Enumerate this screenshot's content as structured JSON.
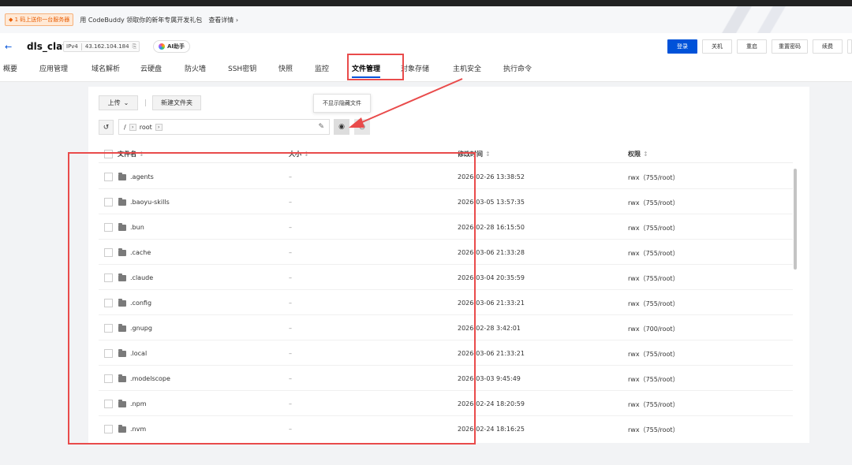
{
  "promo": {
    "tag": "◆ 1 码上送你一台服务器",
    "text": "用 CodeBuddy 领取你的新年专属开发礼包",
    "link": "查看详情 ›"
  },
  "header": {
    "back": "←",
    "instance_name": "dls_claw",
    "ip_type": "IPv4",
    "ip": "43.162.104.184",
    "copy_glyph": "⎘",
    "ai_label": "AI助手",
    "buttons": [
      "登录",
      "关机",
      "重启",
      "重置密码",
      "续费"
    ]
  },
  "tabs": [
    "概要",
    "应用管理",
    "域名解析",
    "云硬盘",
    "防火墙",
    "SSH密钥",
    "快照",
    "监控",
    "文件管理",
    "对象存储",
    "主机安全",
    "执行命令"
  ],
  "active_tab": "文件管理",
  "toolbar": {
    "upload": "上传",
    "upload_chevron": "⌄",
    "divider": "|",
    "new_folder": "新建文件夹",
    "tooltip": "不显示隐藏文件",
    "refresh_glyph": "↺",
    "path_root": "/",
    "path_sep": "›",
    "path_dir": "root",
    "edit_glyph": "✎",
    "eye_glyph": "◉",
    "clock_glyph": "◷"
  },
  "table": {
    "columns": [
      "文件名",
      "大小",
      "修改时间",
      "权限"
    ],
    "sort_glyph": "↕",
    "rows": [
      {
        "name": ".agents",
        "size": "–",
        "time": "2026-02-26 13:38:52",
        "perm": "rwx（755/root）"
      },
      {
        "name": ".baoyu-skills",
        "size": "–",
        "time": "2026-03-05 13:57:35",
        "perm": "rwx（755/root）"
      },
      {
        "name": ".bun",
        "size": "–",
        "time": "2026-02-28 16:15:50",
        "perm": "rwx（755/root）"
      },
      {
        "name": ".cache",
        "size": "–",
        "time": "2026-03-06 21:33:28",
        "perm": "rwx（755/root）"
      },
      {
        "name": ".claude",
        "size": "–",
        "time": "2026-03-04 20:35:59",
        "perm": "rwx（755/root）"
      },
      {
        "name": ".config",
        "size": "–",
        "time": "2026-03-06 21:33:21",
        "perm": "rwx（755/root）"
      },
      {
        "name": ".gnupg",
        "size": "–",
        "time": "2026-02-28 3:42:01",
        "perm": "rwx（700/root）"
      },
      {
        "name": ".local",
        "size": "–",
        "time": "2026-03-06 21:33:21",
        "perm": "rwx（755/root）"
      },
      {
        "name": ".modelscope",
        "size": "–",
        "time": "2026-03-03 9:45:49",
        "perm": "rwx（755/root）"
      },
      {
        "name": ".npm",
        "size": "–",
        "time": "2026-02-24 18:20:59",
        "perm": "rwx（755/root）"
      },
      {
        "name": ".nvm",
        "size": "–",
        "time": "2026-02-24 18:16:25",
        "perm": "rwx（755/root）"
      }
    ]
  },
  "annotation_color": "#e94b4b",
  "accent_color": "#0052d9"
}
